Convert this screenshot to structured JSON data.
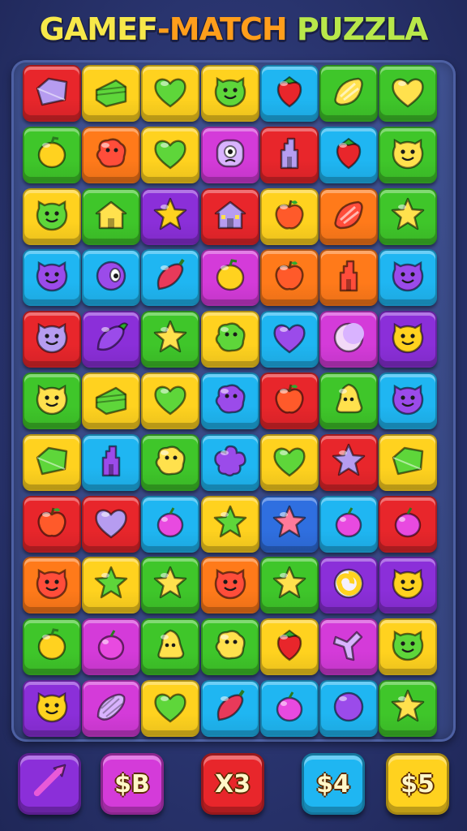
{
  "title": {
    "parts": [
      {
        "text": "GAMEF",
        "color": "#f7e84a"
      },
      {
        "text": "-MATCH",
        "color": "#ff9e1b"
      },
      {
        "text": " PUZZLA",
        "color": "#b9e84a"
      }
    ]
  },
  "colors": {
    "red": "#e8262b",
    "yellow": "#ffd21f",
    "green": "#3fc62a",
    "cyan": "#1fb6f2",
    "purple": "#8b2fd9",
    "magenta": "#d43bd9",
    "orange": "#ff7a1a",
    "blue": "#2f6fe0"
  },
  "board": {
    "rows": [
      [
        {
          "color": "red",
          "icon": "crystal-icon"
        },
        {
          "color": "yellow",
          "icon": "cake-icon"
        },
        {
          "color": "yellow",
          "icon": "heart-icon"
        },
        {
          "color": "yellow",
          "icon": "face-icon"
        },
        {
          "color": "cyan",
          "icon": "strawberry-icon"
        },
        {
          "color": "green",
          "icon": "candy-icon"
        },
        {
          "color": "green",
          "icon": "heart-icon"
        }
      ],
      [
        {
          "color": "green",
          "icon": "lemon-icon"
        },
        {
          "color": "orange",
          "icon": "blob-icon"
        },
        {
          "color": "yellow",
          "icon": "heart-icon"
        },
        {
          "color": "magenta",
          "icon": "monster-icon"
        },
        {
          "color": "red",
          "icon": "castle-icon"
        },
        {
          "color": "cyan",
          "icon": "strawberry-icon"
        },
        {
          "color": "green",
          "icon": "face-icon"
        }
      ],
      [
        {
          "color": "yellow",
          "icon": "face-icon"
        },
        {
          "color": "green",
          "icon": "house-icon"
        },
        {
          "color": "purple",
          "icon": "star-icon"
        },
        {
          "color": "red",
          "icon": "house-icon"
        },
        {
          "color": "yellow",
          "icon": "apple-icon"
        },
        {
          "color": "orange",
          "icon": "candy-icon"
        },
        {
          "color": "green",
          "icon": "star-icon"
        }
      ],
      [
        {
          "color": "cyan",
          "icon": "face-icon"
        },
        {
          "color": "cyan",
          "icon": "eye-icon"
        },
        {
          "color": "cyan",
          "icon": "pepper-icon"
        },
        {
          "color": "magenta",
          "icon": "lemon-icon"
        },
        {
          "color": "orange",
          "icon": "apple-icon"
        },
        {
          "color": "orange",
          "icon": "castle-icon"
        },
        {
          "color": "cyan",
          "icon": "face-icon"
        }
      ],
      [
        {
          "color": "red",
          "icon": "face-icon"
        },
        {
          "color": "purple",
          "icon": "eggplant-icon"
        },
        {
          "color": "green",
          "icon": "star-icon"
        },
        {
          "color": "yellow",
          "icon": "blob-icon"
        },
        {
          "color": "cyan",
          "icon": "heart-icon"
        },
        {
          "color": "magenta",
          "icon": "moon-icon"
        },
        {
          "color": "purple",
          "icon": "face-icon"
        }
      ],
      [
        {
          "color": "green",
          "icon": "face-icon"
        },
        {
          "color": "yellow",
          "icon": "cake-icon"
        },
        {
          "color": "yellow",
          "icon": "heart-icon"
        },
        {
          "color": "cyan",
          "icon": "blob-icon"
        },
        {
          "color": "red",
          "icon": "apple-icon"
        },
        {
          "color": "green",
          "icon": "bell-icon"
        },
        {
          "color": "cyan",
          "icon": "face-icon"
        }
      ],
      [
        {
          "color": "yellow",
          "icon": "crystal-icon"
        },
        {
          "color": "cyan",
          "icon": "castle-icon"
        },
        {
          "color": "green",
          "icon": "blob-icon"
        },
        {
          "color": "cyan",
          "icon": "flower-icon"
        },
        {
          "color": "yellow",
          "icon": "heart-icon"
        },
        {
          "color": "red",
          "icon": "star-icon"
        },
        {
          "color": "yellow",
          "icon": "crystal-icon"
        }
      ],
      [
        {
          "color": "red",
          "icon": "apple-icon"
        },
        {
          "color": "red",
          "icon": "heart-icon"
        },
        {
          "color": "cyan",
          "icon": "plum-icon"
        },
        {
          "color": "yellow",
          "icon": "star-icon"
        },
        {
          "color": "blue",
          "icon": "star-icon"
        },
        {
          "color": "cyan",
          "icon": "plum-icon"
        },
        {
          "color": "red",
          "icon": "plum-icon"
        }
      ],
      [
        {
          "color": "orange",
          "icon": "face-icon"
        },
        {
          "color": "yellow",
          "icon": "star-icon"
        },
        {
          "color": "green",
          "icon": "star-icon"
        },
        {
          "color": "orange",
          "icon": "face-icon"
        },
        {
          "color": "green",
          "icon": "star-icon"
        },
        {
          "color": "purple",
          "icon": "swirl-icon"
        },
        {
          "color": "purple",
          "icon": "face-icon"
        }
      ],
      [
        {
          "color": "green",
          "icon": "lemon-icon"
        },
        {
          "color": "magenta",
          "icon": "plum-icon"
        },
        {
          "color": "green",
          "icon": "bell-icon"
        },
        {
          "color": "green",
          "icon": "blob-icon"
        },
        {
          "color": "yellow",
          "icon": "strawberry-icon"
        },
        {
          "color": "magenta",
          "icon": "leaf-icon"
        },
        {
          "color": "yellow",
          "icon": "face-icon"
        }
      ],
      [
        {
          "color": "purple",
          "icon": "face-icon"
        },
        {
          "color": "magenta",
          "icon": "corn-icon"
        },
        {
          "color": "yellow",
          "icon": "heart-icon"
        },
        {
          "color": "cyan",
          "icon": "pepper-icon"
        },
        {
          "color": "cyan",
          "icon": "plum-icon"
        },
        {
          "color": "cyan",
          "icon": "ball-icon"
        },
        {
          "color": "green",
          "icon": "star-icon"
        }
      ]
    ]
  },
  "boosters": [
    {
      "label": "",
      "icon": "arrow-icon",
      "color": "purple"
    },
    {
      "label": "$B",
      "color": "magenta"
    },
    {
      "label": "X3",
      "color": "red"
    },
    {
      "label": "$4",
      "color": "cyan"
    },
    {
      "label": "$5",
      "color": "yellow"
    }
  ]
}
